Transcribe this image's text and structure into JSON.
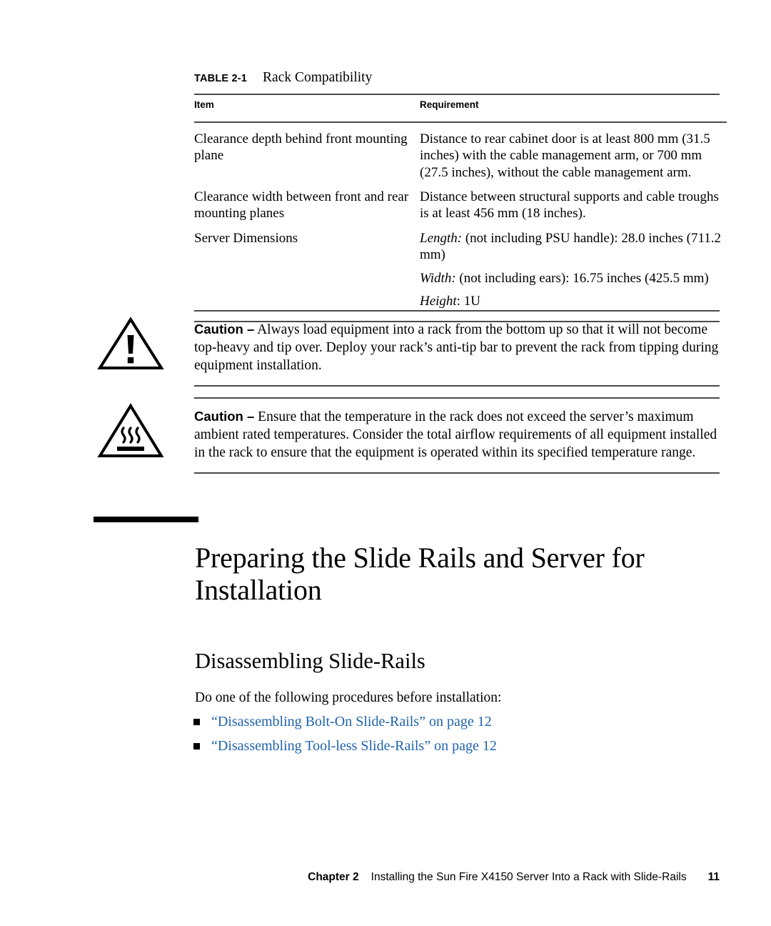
{
  "table": {
    "label": "TABLE 2-1",
    "caption": "Rack Compatibility",
    "headers": [
      "Item",
      "Requirement"
    ],
    "rows": [
      {
        "item": "Clearance depth behind front mounting plane",
        "requirement": "Distance to rear cabinet door is at least 800 mm (31.5 inches) with the cable management arm, or 700 mm (27.5 inches), without the cable management arm."
      },
      {
        "item": "Clearance width between front and rear mounting planes",
        "requirement": "Distance between structural supports and cable troughs is at least 456 mm (18 inches)."
      }
    ],
    "dimensions_row": {
      "item": "Server Dimensions",
      "lines": [
        {
          "term": "Length:",
          "rest": " (not including PSU handle): 28.0 inches (711.2 mm)"
        },
        {
          "term": "Width:",
          "rest": " (not including ears): 16.75 inches (425.5 mm)"
        },
        {
          "term": "Height",
          "rest": ": 1U"
        }
      ]
    }
  },
  "cautions": [
    {
      "icon": "warning-triangle-exclamation-icon",
      "label": "Caution –",
      "body": " Always load equipment into a rack from the bottom up so that it will not become top-heavy and tip over. Deploy your rack’s anti-tip bar to prevent the rack from tipping during equipment installation."
    },
    {
      "icon": "hot-surface-triangle-icon",
      "label": "Caution –",
      "body": " Ensure that the temperature in the rack does not exceed the server’s maximum ambient rated temperatures. Consider the total airflow requirements of all equipment installed in the rack to ensure that the equipment is operated within its specified temperature range."
    }
  ],
  "chapter_title": "Preparing the Slide Rails and Server for Installation",
  "section_title": "Disassembling Slide-Rails",
  "intro_text": "Do one of the following procedures before installation:",
  "links": [
    {
      "text": "“Disassembling Bolt-On Slide-Rails” on page 12"
    },
    {
      "text": "“Disassembling Tool-less Slide-Rails” on page 12"
    }
  ],
  "footer": {
    "chapter": "Chapter 2",
    "title": "Installing the Sun Fire X4150 Server Into a Rack with Slide-Rails",
    "page": "11"
  },
  "colors": {
    "link": "#1f63ad",
    "rule": "#4a4a4a",
    "text": "#000000"
  }
}
